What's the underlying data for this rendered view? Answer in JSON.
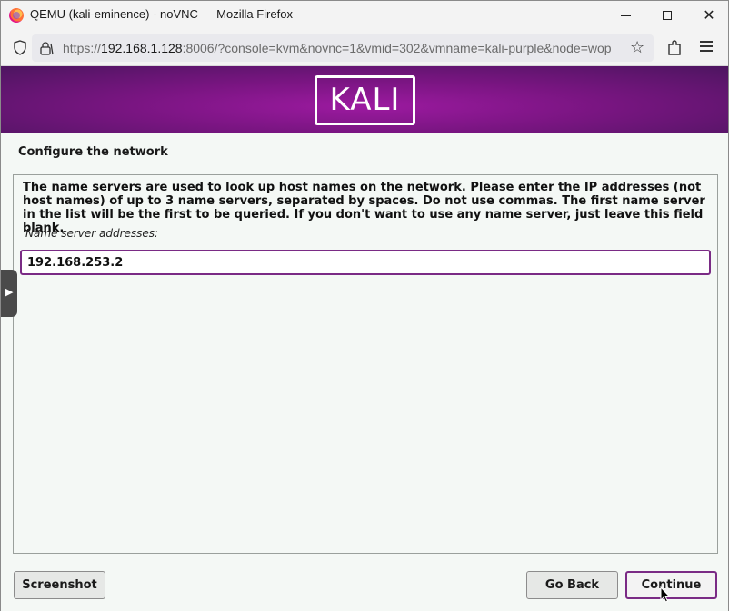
{
  "window": {
    "title": "QEMU (kali-eminence) - noVNC — Mozilla Firefox",
    "min_icon": "minimize-icon",
    "max_icon": "maximize-icon",
    "close_glyph": "✕"
  },
  "browser": {
    "url_prefix": "https://",
    "url_host": "192.168.1.128",
    "url_rest": ":8006/?console=kvm&novnc=1&vmid=302&vmname=kali-purple&node=wop",
    "star_glyph": "☆"
  },
  "installer": {
    "logo_text": "KALI",
    "section_title": "Configure the network",
    "description": "The name servers are used to look up host names on the network. Please enter the IP addresses (not host names) of up to 3 name servers, separated by spaces. Do not use commas. The first name server in the list will be the first to be queried. If you don't want to use any name server, just leave this field blank.",
    "field_label": "Name server addresses:",
    "field_value": "192.168.253.2",
    "side_handle_glyph": "▶"
  },
  "buttons": {
    "screenshot": "Screenshot",
    "go_back": "Go Back",
    "continue": "Continue"
  },
  "colors": {
    "accent": "#7a2b85",
    "banner": "#7a1582"
  }
}
